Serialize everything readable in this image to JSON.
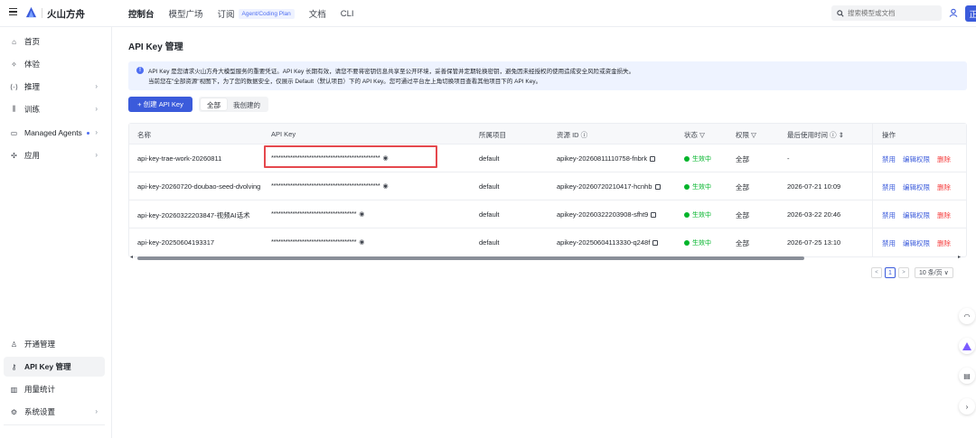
{
  "brand": {
    "name": "火山方舟"
  },
  "nav": {
    "items": [
      {
        "label": "控制台",
        "active": true
      },
      {
        "label": "模型广场"
      },
      {
        "label": "订阅",
        "badge": "Agent/Coding Plan"
      },
      {
        "label": "文档"
      },
      {
        "label": "CLI"
      }
    ],
    "search_placeholder": "搜索模型或文档",
    "avatar_text": "正"
  },
  "sidebar": {
    "items": [
      {
        "label": "首页",
        "icon": "home-icon"
      },
      {
        "label": "体验",
        "icon": "sparkle-icon"
      },
      {
        "label": "推理",
        "icon": "code-icon",
        "chevron": true
      },
      {
        "label": "训练",
        "icon": "tune-icon",
        "chevron": true
      },
      {
        "label": "Managed Agents",
        "icon": "monitor-icon",
        "chevron": true,
        "dot": true
      },
      {
        "label": "应用",
        "icon": "app-icon",
        "chevron": true
      }
    ],
    "bottom": [
      {
        "label": "开通管理",
        "icon": "user-icon"
      },
      {
        "label": "API Key 管理",
        "icon": "key-icon",
        "active": true
      },
      {
        "label": "用量统计",
        "icon": "chart-icon"
      },
      {
        "label": "系统设置",
        "icon": "settings-icon",
        "chevron": true
      }
    ]
  },
  "main": {
    "title": "API Key 管理",
    "notice_line1": "API Key 是您请求火山方舟大模型服务的重要凭证。API Key 长期有效，请您不要将密钥信息共享至公开环境，妥善保管并定期轮换密钥，避免因未经授权的使用造成安全风险或资金损失。",
    "notice_line2": "当前您在\"全部资源\"视图下，为了您的数据安全，仅展示 Default（默认项目）下的 API Key。您可通过平台左上角切换项目查看其他项目下的 API Key。",
    "create_label": "+ 创建 API Key",
    "seg_all": "全部",
    "seg_mine": "我创建的"
  },
  "table": {
    "headers": {
      "name": "名称",
      "key": "API Key",
      "project": "所属项目",
      "resource": "资源 ID ⓘ",
      "status": "状态 ▽",
      "perm": "权限 ▽",
      "last_used": "最后使用时间 ⓘ ⇕",
      "ops": "操作"
    },
    "rows": [
      {
        "name": "api-key-trae-work-20260811",
        "key": "**********************************************",
        "project": "default",
        "resource": "apikey-20260811110758-fnbrk",
        "status": "生效中",
        "perm": "全部",
        "last_used": "-"
      },
      {
        "name": "api-key-20260720-doubao-seed-dvolving",
        "key": "**********************************************",
        "project": "default",
        "resource": "apikey-20260720210417-hcnhb",
        "status": "生效中",
        "perm": "全部",
        "last_used": "2026-07-21 10:09"
      },
      {
        "name": "api-key-20260322203847-视频AI话术",
        "key": "************************************",
        "project": "default",
        "resource": "apikey-20260322203908-sfht9",
        "status": "生效中",
        "perm": "全部",
        "last_used": "2026-03-22 20:46"
      },
      {
        "name": "api-key-20250604193317",
        "key": "************************************",
        "project": "default",
        "resource": "apikey-20250604113330-q248f",
        "status": "生效中",
        "perm": "全部",
        "last_used": "2026-07-25 13:10"
      }
    ],
    "op_disable": "禁用",
    "op_edit": "编辑权限",
    "op_delete": "删除"
  },
  "pager": {
    "prev": "<",
    "page": "1",
    "next": ">",
    "size": "10 条/页 ∨"
  },
  "colors": {
    "accent": "#3b5bdb",
    "danger": "#f53f3f",
    "success": "#00b42a",
    "highlight": "#e5484d"
  }
}
